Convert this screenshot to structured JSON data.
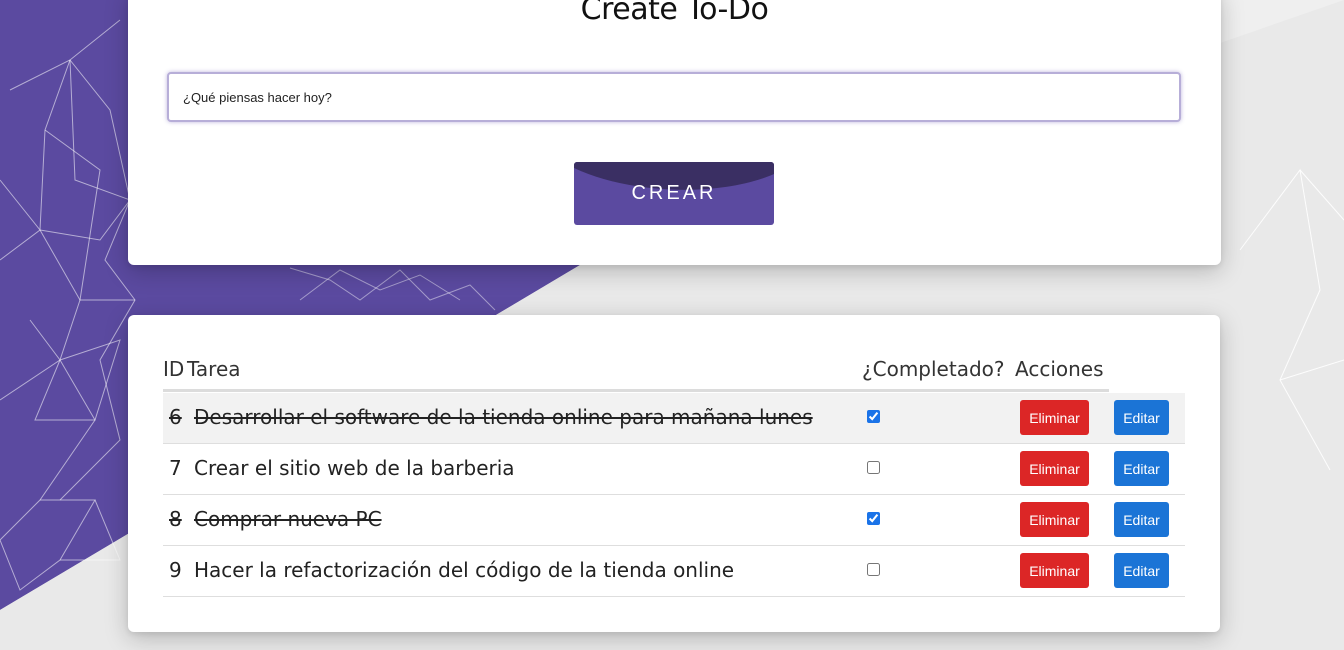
{
  "create": {
    "title": "Create To-Do",
    "input_placeholder": "¿Qué piensas hacer hoy?",
    "button_label": "CREAR"
  },
  "table": {
    "headers": {
      "id": "ID",
      "task": "Tarea",
      "completed": "¿Completado?",
      "actions": "Acciones"
    },
    "delete_label": "Eliminar",
    "edit_label": "Editar",
    "rows": [
      {
        "id": "6",
        "task": "Desarrollar el software de la tienda online para mañana lunes",
        "completed": true
      },
      {
        "id": "7",
        "task": "Crear el sitio web de la barberia",
        "completed": false
      },
      {
        "id": "8",
        "task": "Comprar nueva PC",
        "completed": true
      },
      {
        "id": "9",
        "task": "Hacer la refactorización del código de la tienda online",
        "completed": false
      }
    ]
  },
  "colors": {
    "brand_purple": "#5b4aa0",
    "delete_red": "#dc2626",
    "edit_blue": "#1b74d6",
    "checkbox_blue": "#1a73e8"
  }
}
